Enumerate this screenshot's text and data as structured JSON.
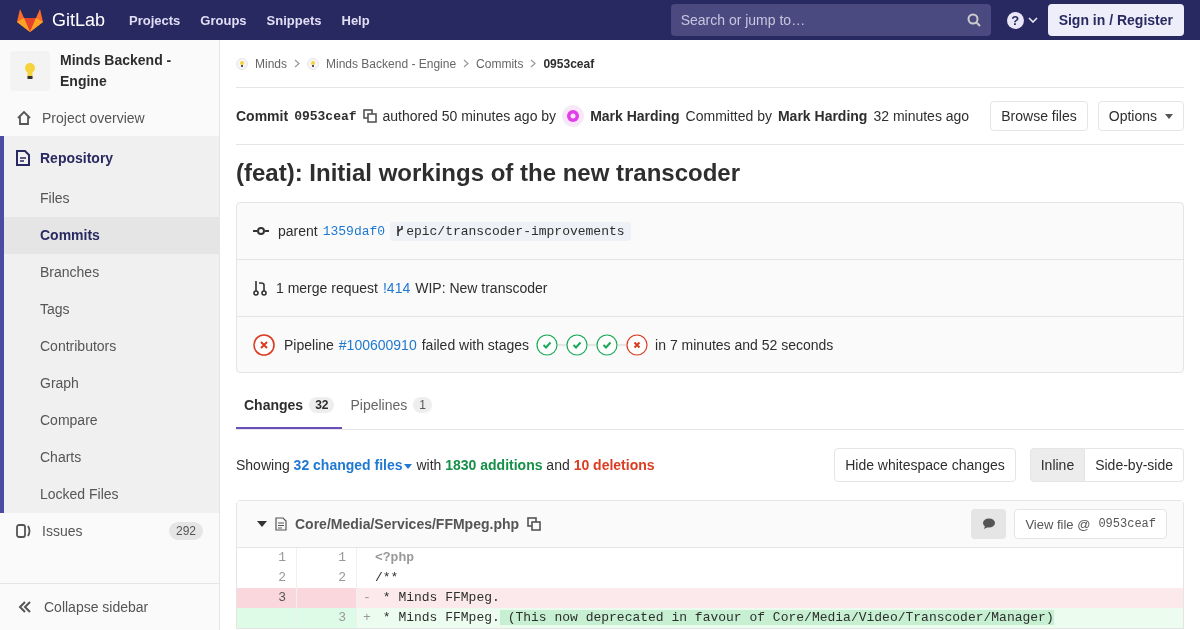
{
  "navbar": {
    "logo_text": "GitLab",
    "links": [
      "Projects",
      "Groups",
      "Snippets",
      "Help"
    ],
    "search": {
      "placeholder": "Search or jump to…"
    },
    "help": "?",
    "sign_in": "Sign in / Register"
  },
  "sidebar": {
    "project_name": "Minds Backend - Engine",
    "items": [
      {
        "label": "Project overview",
        "kind": "home",
        "selected": false
      },
      {
        "label": "Repository",
        "kind": "repo",
        "selected": true,
        "children": [
          {
            "label": "Files",
            "selected": false
          },
          {
            "label": "Commits",
            "selected": true
          },
          {
            "label": "Branches",
            "selected": false
          },
          {
            "label": "Tags",
            "selected": false
          },
          {
            "label": "Contributors",
            "selected": false
          },
          {
            "label": "Graph",
            "selected": false
          },
          {
            "label": "Compare",
            "selected": false
          },
          {
            "label": "Charts",
            "selected": false
          },
          {
            "label": "Locked Files",
            "selected": false
          }
        ]
      },
      {
        "label": "Issues",
        "kind": "issues",
        "selected": false,
        "count": "292"
      }
    ],
    "collapse": "Collapse sidebar"
  },
  "breadcrumbs": [
    {
      "label": "Minds",
      "kind": "project"
    },
    {
      "label": "Minds Backend - Engine",
      "kind": "project"
    },
    {
      "label": "Commits",
      "kind": "page"
    },
    {
      "label": "0953ceaf",
      "kind": "page"
    }
  ],
  "commit": {
    "label": "Commit",
    "sha": "0953ceaf",
    "authored": "authored 50 minutes ago by",
    "author": "Mark Harding",
    "committed_by": "Committed by",
    "committer": "Mark Harding",
    "committed_ago": "32 minutes ago",
    "buttons": [
      "Browse files",
      "Options"
    ]
  },
  "title": "(feat): Initial workings of the new transcoder",
  "info": {
    "parent_label": "parent",
    "parent_sha": "1359daf0",
    "branch": "epic/transcoder-improvements",
    "merge_requests": "1 merge request",
    "mr_id": "!414",
    "mr_title": "WIP: New transcoder",
    "pipeline": {
      "kind": "failed",
      "label": "Pipeline",
      "id": "#100600910",
      "status_text": "failed with stages",
      "stages": [
        {
          "kind": "success"
        },
        {
          "kind": "success"
        },
        {
          "kind": "success"
        },
        {
          "kind": "failed"
        }
      ],
      "duration": "in 7 minutes and 52 seconds"
    }
  },
  "tabs": [
    {
      "label": "Changes",
      "count": "32",
      "selected": true
    },
    {
      "label": "Pipelines",
      "count": "1",
      "selected": false
    }
  ],
  "summary": {
    "showing": "Showing",
    "files": "32 changed files",
    "with": "with",
    "additions": "1830 additions",
    "and": "and",
    "deletions": "10 deletions"
  },
  "whitespace_button": "Hide whitespace changes",
  "view_modes": [
    {
      "label": "Inline",
      "selected": true
    },
    {
      "label": "Side-by-side",
      "selected": false
    }
  ],
  "file": {
    "path": "Core/Media/Services/FFMpeg.php",
    "view_file": "View file @",
    "sha": "0953ceaf",
    "lines": [
      {
        "kind": "context",
        "old": "1",
        "new": "1",
        "code": "<?php"
      },
      {
        "kind": "context",
        "old": "2",
        "new": "2",
        "code": "/**"
      },
      {
        "kind": "removed",
        "old": "3",
        "sign": "-",
        "code": " * Minds FFMpeg."
      },
      {
        "kind": "added",
        "new": "3",
        "sign": "+",
        "code": " * Minds FFMpeg.",
        "changed": "(This now deprecated in favour of Core/Media/Video/Transcoder/Manager)"
      }
    ]
  }
}
